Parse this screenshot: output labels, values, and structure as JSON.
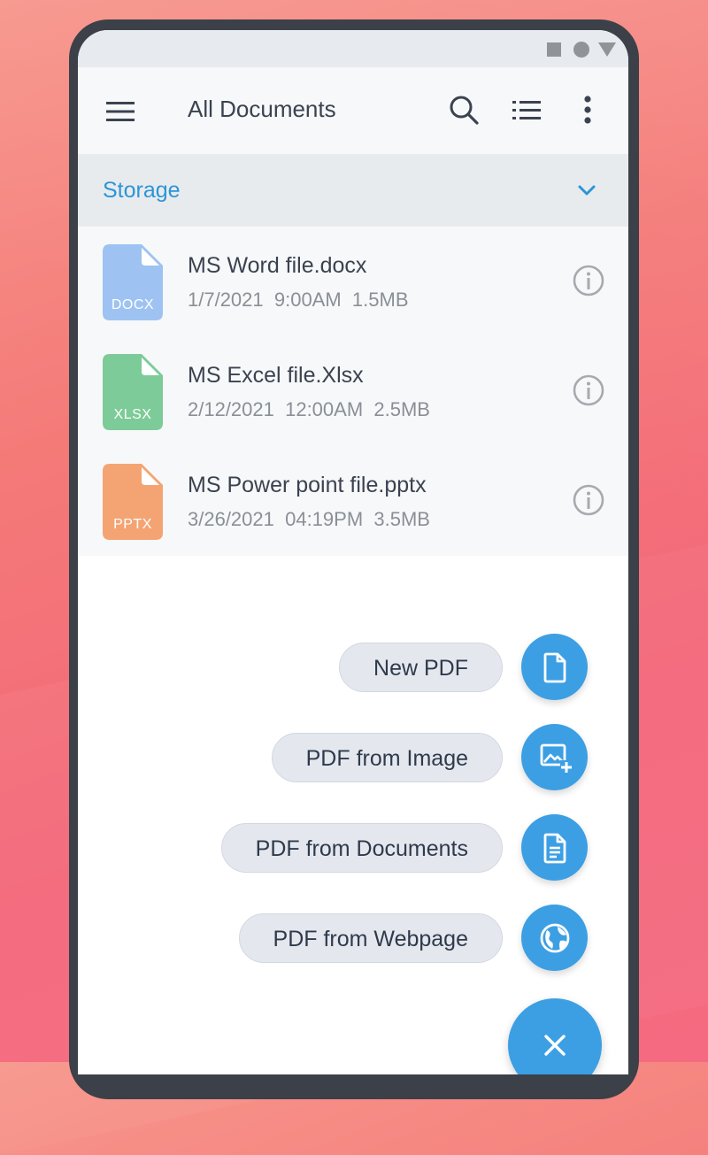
{
  "app": {
    "title": "All Documents"
  },
  "storage": {
    "label": "Storage"
  },
  "files": [
    {
      "name": "MS Word file.docx",
      "meta": "1/7/2021  9:00AM  1.5MB",
      "ext": "DOCX",
      "color": "#9ec3f2"
    },
    {
      "name": "MS Excel file.Xlsx",
      "meta": "2/12/2021  12:00AM  2.5MB",
      "ext": "XLSX",
      "color": "#7dcb98"
    },
    {
      "name": "MS Power point file.pptx",
      "meta": "3/26/2021  04:19PM  3.5MB",
      "ext": "PPTX",
      "color": "#f4a473"
    }
  ],
  "fab_actions": [
    {
      "label": "New PDF",
      "icon": "document-icon"
    },
    {
      "label": "PDF from Image",
      "icon": "add-image-icon"
    },
    {
      "label": "PDF from Documents",
      "icon": "text-document-icon"
    },
    {
      "label": "PDF from Webpage",
      "icon": "globe-icon"
    }
  ],
  "colors": {
    "accent": "#3c9fe4",
    "storage_text": "#2c95d6"
  }
}
